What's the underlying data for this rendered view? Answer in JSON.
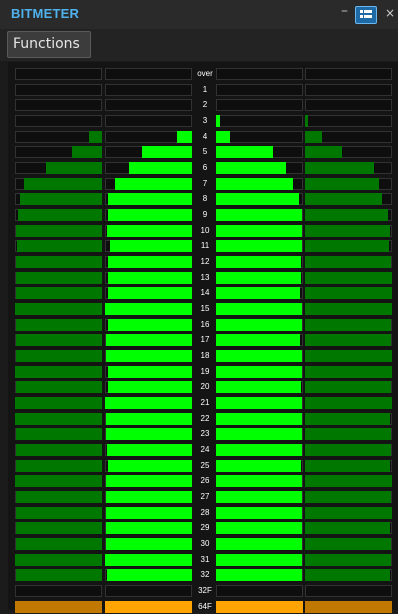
{
  "app": {
    "title": "BITMETER",
    "functions_label": "Functions"
  },
  "icons": {
    "minimize": "minimize-icon",
    "layout": "layout-toggle-icon",
    "close": "close-icon"
  },
  "colors": {
    "title": "#4fb2ec",
    "bright_green": "#00ff00",
    "dark_green": "#007800",
    "empty_cell": "#0e0e0e",
    "empty_border": "#323232",
    "orange_bright": "#ffa400",
    "orange_dark": "#c07800",
    "background": "#141414"
  },
  "bitmeter": {
    "rows": [
      {
        "label": "over",
        "levels": [
          0,
          0,
          0,
          0
        ],
        "kind": "over"
      },
      {
        "label": "1",
        "levels": [
          0,
          0,
          0,
          0
        ],
        "kind": "bit"
      },
      {
        "label": "2",
        "levels": [
          0,
          0,
          0,
          0
        ],
        "kind": "bit"
      },
      {
        "label": "3",
        "levels": [
          0,
          0,
          0.05,
          0.04
        ],
        "kind": "bit"
      },
      {
        "label": "4",
        "levels": [
          0.15,
          0.17,
          0.16,
          0.2
        ],
        "kind": "bit"
      },
      {
        "label": "5",
        "levels": [
          0.34,
          0.58,
          0.66,
          0.43
        ],
        "kind": "bit"
      },
      {
        "label": "6",
        "levels": [
          0.64,
          0.72,
          0.8,
          0.79
        ],
        "kind": "bit"
      },
      {
        "label": "7",
        "levels": [
          0.9,
          0.88,
          0.88,
          0.85
        ],
        "kind": "bit"
      },
      {
        "label": "8",
        "levels": [
          0.94,
          0.96,
          0.95,
          0.89
        ],
        "kind": "bit"
      },
      {
        "label": "9",
        "levels": [
          0.96,
          0.96,
          0.99,
          0.95
        ],
        "kind": "bit"
      },
      {
        "label": "10",
        "levels": [
          0.99,
          0.98,
          0.99,
          0.98
        ],
        "kind": "bit"
      },
      {
        "label": "11",
        "levels": [
          0.98,
          0.94,
          0.99,
          0.97
        ],
        "kind": "bit"
      },
      {
        "label": "12",
        "levels": [
          0.99,
          0.96,
          0.98,
          0.99
        ],
        "kind": "bit"
      },
      {
        "label": "13",
        "levels": [
          0.99,
          0.97,
          0.98,
          1
        ],
        "kind": "bit"
      },
      {
        "label": "14",
        "levels": [
          0.99,
          0.97,
          0.97,
          1
        ],
        "kind": "bit"
      },
      {
        "label": "15",
        "levels": [
          1,
          1,
          0.99,
          1
        ],
        "kind": "bit"
      },
      {
        "label": "16",
        "levels": [
          0.99,
          0.97,
          0.99,
          0.99
        ],
        "kind": "bit"
      },
      {
        "label": "17",
        "levels": [
          0.99,
          0.99,
          0.97,
          0.99
        ],
        "kind": "bit"
      },
      {
        "label": "18",
        "levels": [
          0.99,
          0.99,
          0.99,
          1
        ],
        "kind": "bit"
      },
      {
        "label": "19",
        "levels": [
          1,
          0.96,
          0.99,
          1
        ],
        "kind": "bit"
      },
      {
        "label": "20",
        "levels": [
          0.99,
          0.97,
          0.98,
          0.99
        ],
        "kind": "bit"
      },
      {
        "label": "21",
        "levels": [
          1,
          1,
          0.99,
          1
        ],
        "kind": "bit"
      },
      {
        "label": "22",
        "levels": [
          1,
          0.99,
          0.99,
          0.98
        ],
        "kind": "bit"
      },
      {
        "label": "23",
        "levels": [
          0.99,
          0.99,
          0.99,
          0.99
        ],
        "kind": "bit"
      },
      {
        "label": "24",
        "levels": [
          0.99,
          0.98,
          0.99,
          0.99
        ],
        "kind": "bit"
      },
      {
        "label": "25",
        "levels": [
          0.99,
          0.96,
          0.98,
          0.98
        ],
        "kind": "bit"
      },
      {
        "label": "26",
        "levels": [
          1,
          0.99,
          0.99,
          1
        ],
        "kind": "bit"
      },
      {
        "label": "27",
        "levels": [
          0.99,
          0.99,
          0.99,
          0.99
        ],
        "kind": "bit"
      },
      {
        "label": "28",
        "levels": [
          0.99,
          0.99,
          0.99,
          1
        ],
        "kind": "bit"
      },
      {
        "label": "29",
        "levels": [
          0.99,
          0.99,
          0.99,
          0.98
        ],
        "kind": "bit"
      },
      {
        "label": "30",
        "levels": [
          0.99,
          0.99,
          0.99,
          0.99
        ],
        "kind": "bit"
      },
      {
        "label": "31",
        "levels": [
          1,
          1,
          0.99,
          0.99
        ],
        "kind": "bit"
      },
      {
        "label": "32",
        "levels": [
          0.99,
          0.98,
          0.99,
          0.98
        ],
        "kind": "bit"
      },
      {
        "label": "32F",
        "levels": [
          0,
          0,
          0,
          0
        ],
        "kind": "float"
      },
      {
        "label": "64F",
        "levels": [
          1,
          1,
          1,
          1
        ],
        "kind": "float"
      }
    ]
  }
}
